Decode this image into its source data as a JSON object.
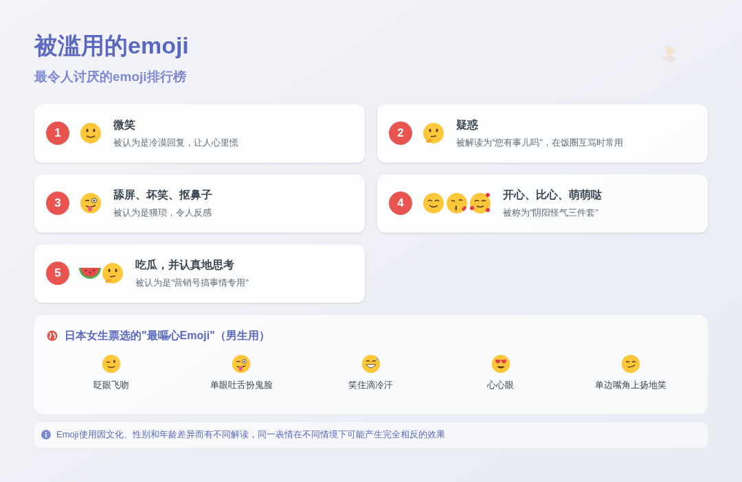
{
  "title": "被滥用的emoji",
  "subtitle": "最令人讨厌的emoji排行榜",
  "ranking": [
    {
      "rank": "1",
      "name": "微笑",
      "description": "被认为是冷漠回复，让人心里慌"
    },
    {
      "rank": "2",
      "name": "疑惑",
      "description": "被解读为\"您有事儿吗\"，在饭圈互骂时常用"
    },
    {
      "rank": "3",
      "name": "舔屏、坏笑、抠鼻子",
      "description": "被认为是猥琐，令人反感"
    },
    {
      "rank": "4",
      "name": "开心、比心、萌萌哒",
      "description": "被称为\"阴阳怪气三件套\""
    },
    {
      "rank": "5",
      "name": "吃瓜，并认真地思考",
      "description": "被认为是\"营销号搞事情专用\""
    }
  ],
  "japan_poll": {
    "title": "日本女生票选的\"最嘔心Emoji\"（男生用）",
    "items": [
      {
        "label": "眨眼飞吻"
      },
      {
        "label": "单眼吐舌扮鬼脸"
      },
      {
        "label": "笑住滴冷汗"
      },
      {
        "label": "心心眼"
      },
      {
        "label": "单边嘴角上扬地笑"
      }
    ]
  },
  "note": "Emoji使用因文化、性别和年龄差异而有不同解读，同一表情在不同情境下可能产生完全相反的效果"
}
